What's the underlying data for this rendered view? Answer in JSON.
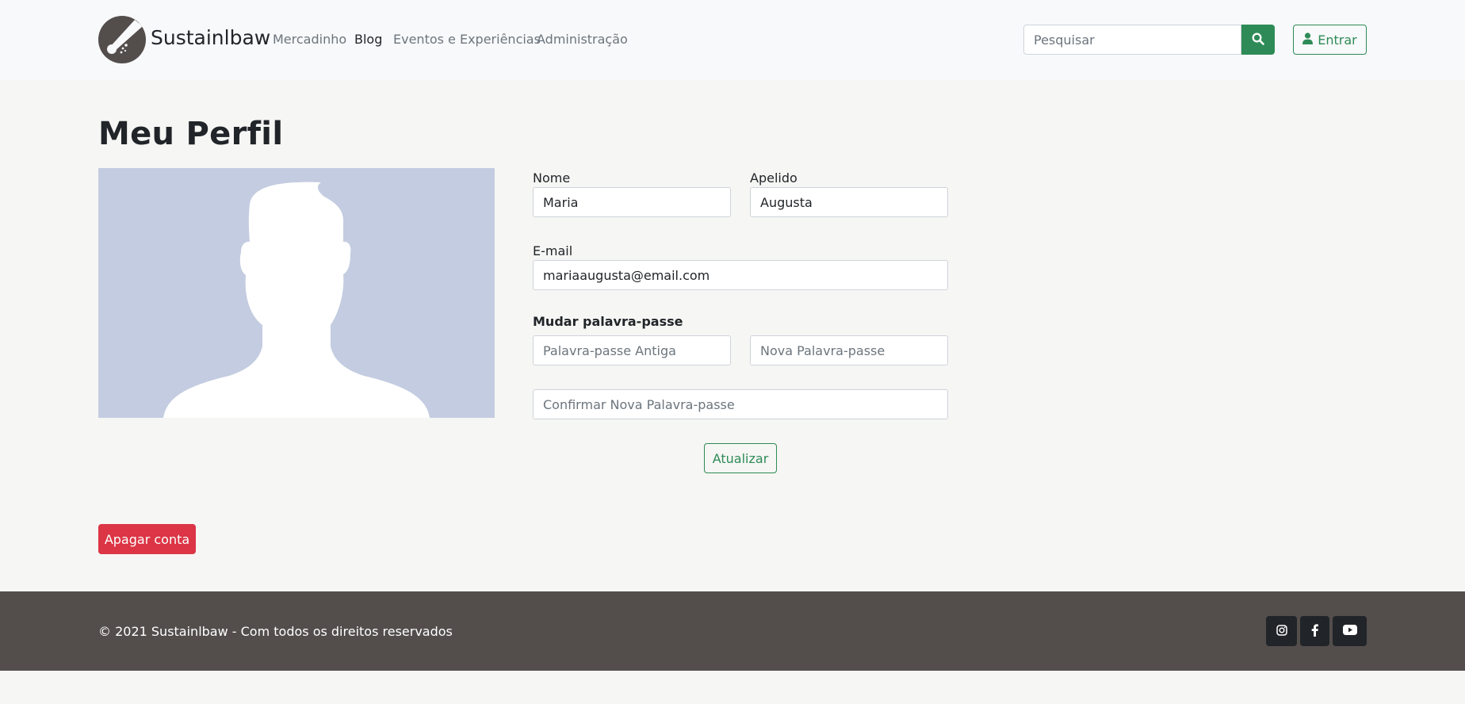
{
  "header": {
    "brand": "Sustainlbaw",
    "nav": [
      "Mercadinho",
      "Blog",
      "Eventos e Experiências",
      "Administração"
    ],
    "active_nav": "Blog",
    "search_placeholder": "Pesquisar",
    "login_label": "Entrar"
  },
  "profile": {
    "title": "Meu Perfil",
    "first_name_label": "Nome",
    "first_name_value": "Maria",
    "last_name_label": "Apelido",
    "last_name_value": "Augusta",
    "email_label": "E-mail",
    "email_value": "mariaaugusta@email.com",
    "password_section_label": "Mudar palavra-passe",
    "old_password_placeholder": "Palavra-passe Antiga",
    "new_password_placeholder": "Nova Palavra-passe",
    "confirm_password_placeholder": "Confirmar Nova Palavra-passe",
    "update_label": "Atualizar",
    "delete_label": "Apagar conta"
  },
  "footer": {
    "copyright": "© 2021 Sustainlbaw - Com todos os direitos reservados",
    "social_icons": [
      "instagram-icon",
      "facebook-icon",
      "youtube-icon"
    ]
  },
  "colors": {
    "primary_green": "#2e8b57",
    "danger_red": "#dc3545",
    "footer_bg": "#534d4c",
    "avatar_bg": "#c3cce0"
  }
}
